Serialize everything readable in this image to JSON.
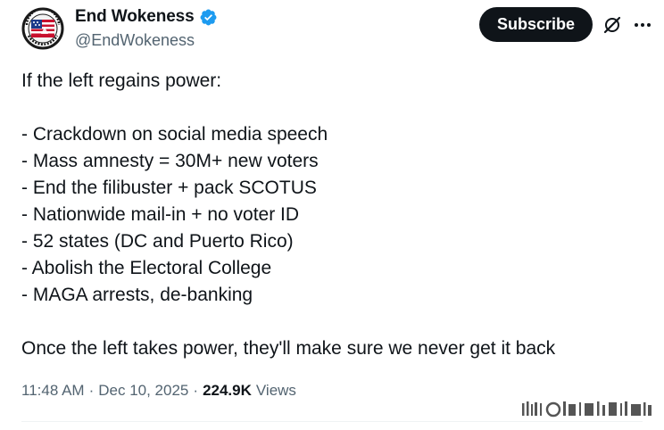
{
  "author": {
    "display_name": "End Wokeness",
    "handle": "@EndWokeness",
    "avatar_icon": "american-flag-seal-avatar",
    "verified_icon": "verified-badge-icon",
    "verified_color": "#1d9bf0"
  },
  "actions": {
    "subscribe_label": "Subscribe",
    "grok_icon": "grok-icon",
    "more_icon": "more-options-icon"
  },
  "tweet": {
    "lines": [
      "If the left regains power:",
      "",
      "- Crackdown on social media speech",
      "- Mass amnesty = 30M+ new voters",
      "- End the filibuster + pack SCOTUS",
      "- Nationwide mail-in + no voter ID",
      "- 52 states (DC and Puerto Rico)",
      "- Abolish the Electoral College",
      "- MAGA arrests, de-banking",
      "",
      "Once the left takes power, they'll make sure we never get it back"
    ]
  },
  "meta": {
    "time": "11:48 AM",
    "separator": "·",
    "date": "Dec 10, 2025",
    "views_count": "224.9K",
    "views_label": "Views"
  },
  "colors": {
    "text": "#0f1419",
    "secondary": "#536471",
    "button_bg": "#0f1419"
  }
}
